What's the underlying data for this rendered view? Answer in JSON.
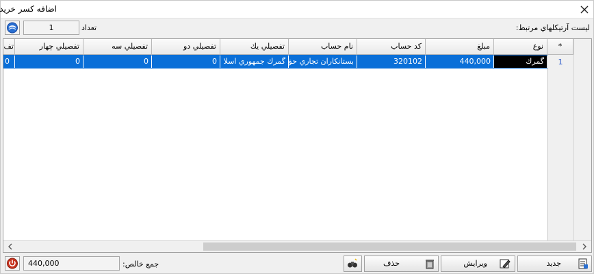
{
  "window": {
    "title": "اضافه كسر خريد"
  },
  "list_label": "ليست آرتيكلهاي مرتبط:",
  "count": {
    "label": "تعداد",
    "value": "1"
  },
  "grid": {
    "corner": "*",
    "columns": [
      "نوع",
      "مبلغ",
      "كد حساب",
      "نام حساب",
      "تفصيلي يك",
      "تفصيلي دو",
      "تفصيلي سه",
      "تفصيلي چهار",
      "تف"
    ],
    "rows": [
      {
        "num": "1",
        "cells": [
          "گمرك",
          "440,000",
          "320102",
          "بستانكاران تجاري حق",
          "گمرك جمهوري اسلا",
          "0",
          "0",
          "0",
          "0"
        ]
      }
    ]
  },
  "buttons": {
    "new": "جديد",
    "edit": "ويرايش",
    "delete": "حذف"
  },
  "net_total": {
    "label": "جمع خالص:",
    "value": "440,000"
  },
  "colors": {
    "selection": "#0a6fd8",
    "type_cell": "#000000"
  }
}
